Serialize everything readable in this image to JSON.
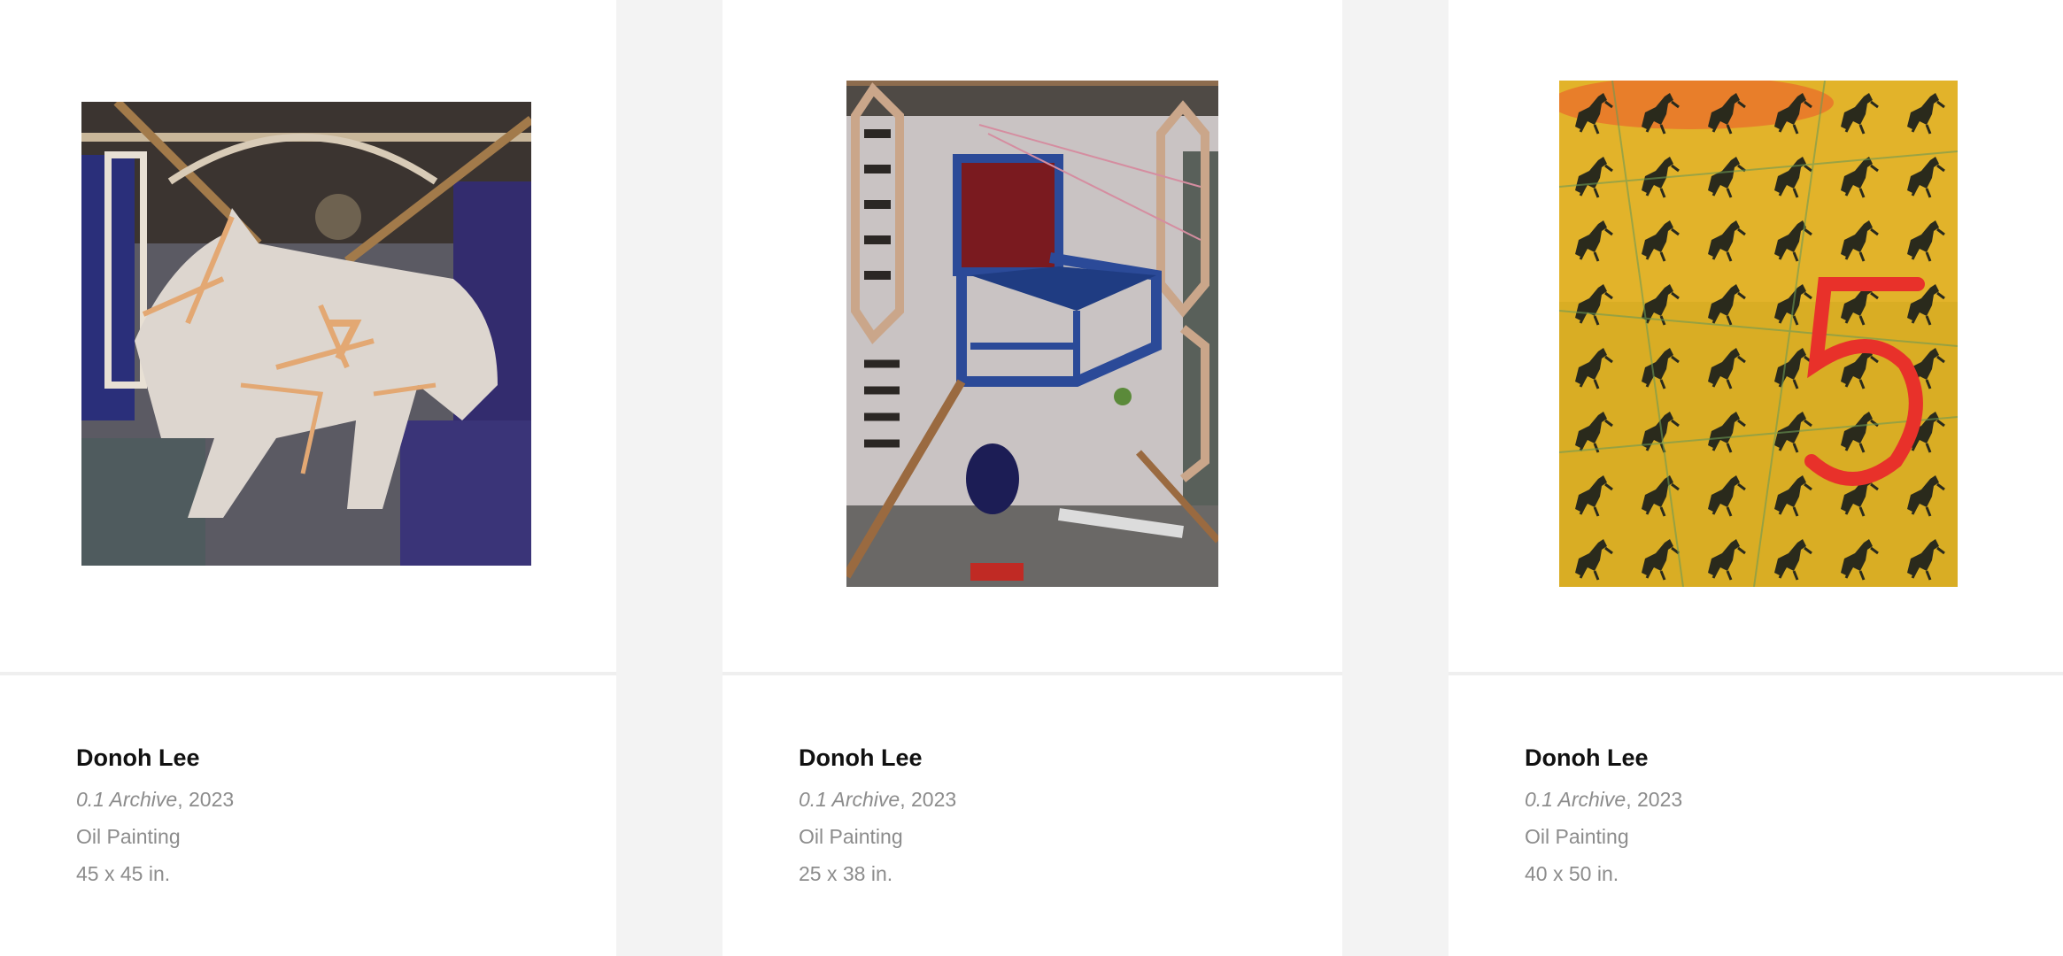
{
  "artworks": [
    {
      "artist": "Donoh Lee",
      "title": "0.1 Archive",
      "year_sep": ", ",
      "year": "2023",
      "medium": "Oil Painting",
      "size": "45 x 45 in.",
      "image": "white horse painting with number 7"
    },
    {
      "artist": "Donoh Lee",
      "title": "0.1 Archive",
      "year_sep": ", ",
      "year": "2023",
      "medium": "Oil Painting",
      "size": "25 x 38 in.",
      "image": "interior with blue chair painting"
    },
    {
      "artist": "Donoh Lee",
      "title": "0.1 Archive",
      "year_sep": ", ",
      "year": "2023",
      "medium": "Oil Painting",
      "size": "40 x 50 in.",
      "image": "yellow pattern of prancing horses with red number 5"
    }
  ],
  "colors": {
    "page_background": "#f3f3f3",
    "card_background": "#ffffff",
    "artist_text": "#111111",
    "meta_text": "#8c8c8c"
  }
}
